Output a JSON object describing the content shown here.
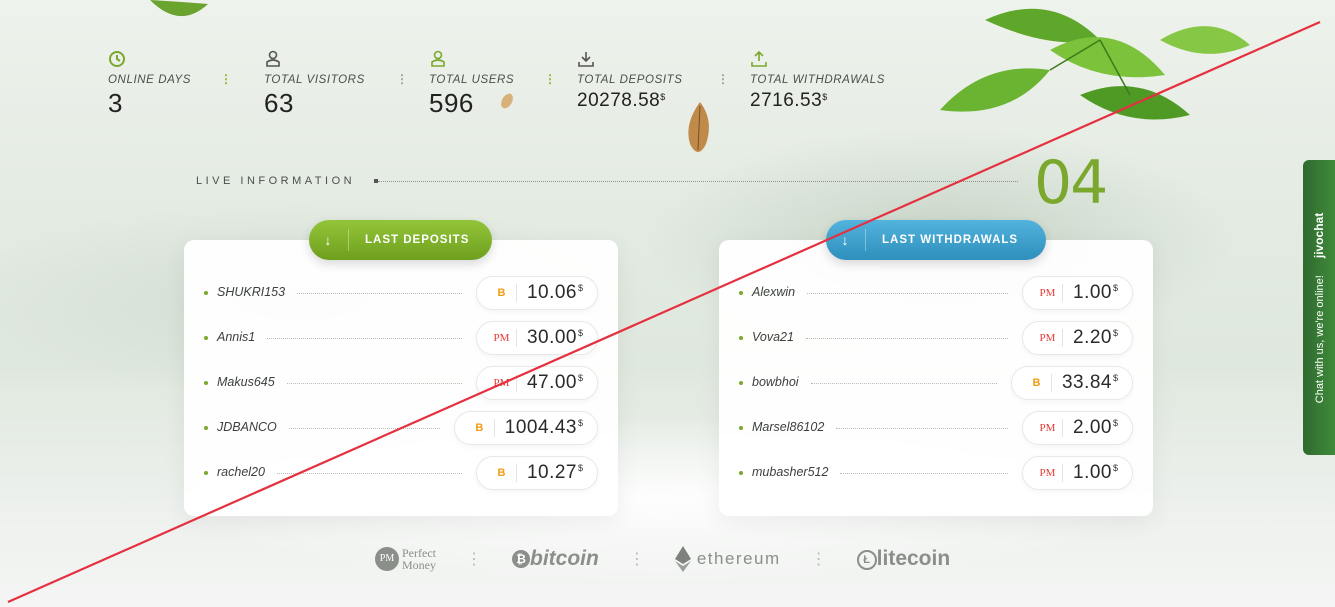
{
  "stats": [
    {
      "icon": "clock-icon",
      "label": "ONLINE DAYS",
      "value": "3",
      "currency": ""
    },
    {
      "icon": "user-icon",
      "label": "TOTAL VISITORS",
      "value": "63",
      "currency": ""
    },
    {
      "icon": "user-icon",
      "label": "TOTAL USERS",
      "value": "596",
      "currency": ""
    },
    {
      "icon": "download-icon",
      "label": "TOTAL DEPOSITS",
      "value": "20278.58",
      "currency": "$"
    },
    {
      "icon": "upload-icon",
      "label": "TOTAL WITHDRAWALS",
      "value": "2716.53",
      "currency": "$"
    }
  ],
  "live_info": "LIVE INFORMATION",
  "section_number": "04",
  "deposits": {
    "button_label": "LAST DEPOSITS",
    "rows": [
      {
        "name": "SHUKRI153",
        "method": "bitcoin",
        "method_label": "B",
        "amount": "10.06",
        "currency": "$"
      },
      {
        "name": "Annis1",
        "method": "perfect-money",
        "method_label": "PM",
        "amount": "30.00",
        "currency": "$"
      },
      {
        "name": "Makus645",
        "method": "perfect-money",
        "method_label": "PM",
        "amount": "47.00",
        "currency": "$"
      },
      {
        "name": "JDBANCO",
        "method": "bitcoin",
        "method_label": "B",
        "amount": "1004.43",
        "currency": "$"
      },
      {
        "name": "rachel20",
        "method": "bitcoin",
        "method_label": "B",
        "amount": "10.27",
        "currency": "$"
      }
    ]
  },
  "withdrawals": {
    "button_label": "LAST WITHDRAWALS",
    "rows": [
      {
        "name": "Alexwin",
        "method": "perfect-money",
        "method_label": "PM",
        "amount": "1.00",
        "currency": "$"
      },
      {
        "name": "Vova21",
        "method": "perfect-money",
        "method_label": "PM",
        "amount": "2.20",
        "currency": "$"
      },
      {
        "name": "bowbhoi",
        "method": "bitcoin",
        "method_label": "B",
        "amount": "33.84",
        "currency": "$"
      },
      {
        "name": "Marsel86102",
        "method": "perfect-money",
        "method_label": "PM",
        "amount": "2.00",
        "currency": "$"
      },
      {
        "name": "mubasher512",
        "method": "perfect-money",
        "method_label": "PM",
        "amount": "1.00",
        "currency": "$"
      }
    ]
  },
  "payment_logos": {
    "perfect_money_mark": "PM",
    "perfect_money_line1": "Perfect",
    "perfect_money_line2": "Money",
    "bitcoin": "bitcoin",
    "ethereum": "ethereum",
    "litecoin": "litecoin"
  },
  "chat": {
    "brand": "jivochat",
    "text": "Chat with us, we're online!"
  },
  "colors": {
    "accent_green": "#7aa82e",
    "accent_blue": "#3a9fcc",
    "bitcoin_orange": "#f39c12",
    "pm_red": "#e53935",
    "overlay_line_red": "#e53040"
  }
}
